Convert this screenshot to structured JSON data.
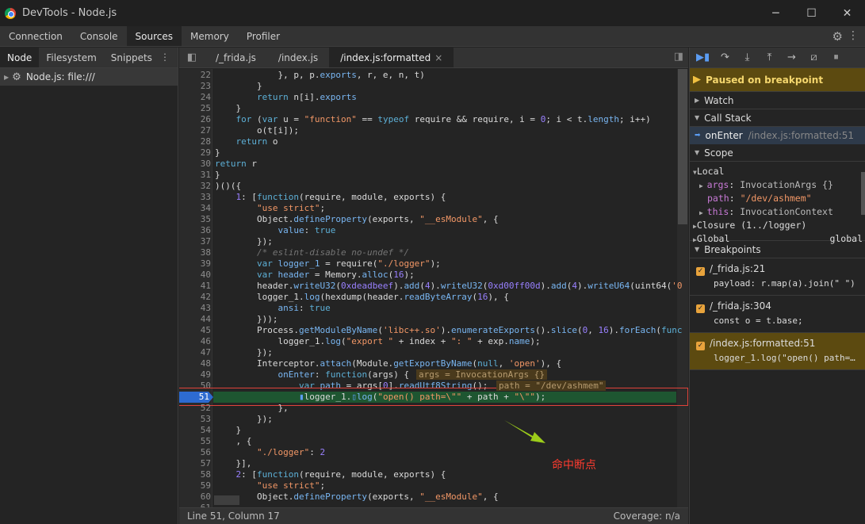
{
  "window": {
    "title": "DevTools - Node.js",
    "minimize": "─",
    "maximize": "☐",
    "close": "✕"
  },
  "main_tabs": [
    "Connection",
    "Console",
    "Sources",
    "Memory",
    "Profiler"
  ],
  "left": {
    "tabs": [
      "Node",
      "Filesystem",
      "Snippets"
    ],
    "more": "⋮",
    "tree_item": "Node.js: file:///"
  },
  "file_tabs": [
    "/_frida.js",
    "/index.js",
    "/index.js:formatted"
  ],
  "close_glyph": "×",
  "code": {
    "highlight_line": 51,
    "lines": [
      {
        "n": "22",
        "h": "            }, p, p.<span class=\"p\">exports</span>, r, e, n, t)"
      },
      {
        "n": "23",
        "h": "        }"
      },
      {
        "n": "24",
        "h": "        <span class=\"k\">return</span> n[i].<span class=\"p\">exports</span>"
      },
      {
        "n": "25",
        "h": "    }"
      },
      {
        "n": "26",
        "h": "    <span class=\"k\">for</span> (<span class=\"k\">var</span> u = <span class=\"s\">\"function\"</span> == <span class=\"k\">typeof</span> require &amp;&amp; require, i = <span class=\"n\">0</span>; i &lt; t.<span class=\"p\">length</span>; i++)"
      },
      {
        "n": "27",
        "h": "        o(t[i]);"
      },
      {
        "n": "28",
        "h": "    <span class=\"k\">return</span> o"
      },
      {
        "n": "29",
        "h": "}"
      },
      {
        "n": "30",
        "h": "<span class=\"k\">return</span> r"
      },
      {
        "n": "31",
        "h": "}"
      },
      {
        "n": "32",
        "h": ")()({"
      },
      {
        "n": "33",
        "h": "    <span class=\"n\">1</span>: [<span class=\"k\">function</span>(require, module, exports) {"
      },
      {
        "n": "34",
        "h": "        <span class=\"s\">\"use strict\"</span>;"
      },
      {
        "n": "35",
        "h": "        Object.<span class=\"p\">defineProperty</span>(exports, <span class=\"s\">\"__esModule\"</span>, {"
      },
      {
        "n": "36",
        "h": "            <span class=\"p\">value</span>: <span class=\"k\">true</span>"
      },
      {
        "n": "37",
        "h": "        });"
      },
      {
        "n": "38",
        "h": "        <span class=\"c\">/* eslint-disable no-undef */</span>"
      },
      {
        "n": "39",
        "h": "        <span class=\"k\">var</span> <span class=\"p\">logger_1</span> = require(<span class=\"s\">\"./logger\"</span>);"
      },
      {
        "n": "40",
        "h": "        <span class=\"k\">var</span> <span class=\"p\">header</span> = Memory.<span class=\"p\">alloc</span>(<span class=\"n\">16</span>);"
      },
      {
        "n": "41",
        "h": "        header.<span class=\"p\">writeU32</span>(<span class=\"n\">0xdeadbeef</span>).<span class=\"p\">add</span>(<span class=\"n\">4</span>).<span class=\"p\">writeU32</span>(<span class=\"n\">0xd00ff00d</span>).<span class=\"p\">add</span>(<span class=\"n\">4</span>).<span class=\"p\">writeU64</span>(uint64(<span class=\"s\">'0</span>"
      },
      {
        "n": "42",
        "h": "        logger_1.<span class=\"p\">log</span>(hexdump(header.<span class=\"p\">readByteArray</span>(<span class=\"n\">16</span>), {"
      },
      {
        "n": "43",
        "h": "            <span class=\"p\">ansi</span>: <span class=\"k\">true</span>"
      },
      {
        "n": "44",
        "h": "        }));"
      },
      {
        "n": "45",
        "h": "        Process.<span class=\"p\">getModuleByName</span>(<span class=\"s\">'libc++.so'</span>).<span class=\"p\">enumerateExports</span>().<span class=\"p\">slice</span>(<span class=\"n\">0</span>, <span class=\"n\">16</span>).<span class=\"p\">forEach</span>(<span class=\"k\">func</span>"
      },
      {
        "n": "46",
        "h": "            logger_1.<span class=\"p\">log</span>(<span class=\"s\">\"export \"</span> + index + <span class=\"s\">\": \"</span> + exp.<span class=\"p\">name</span>);"
      },
      {
        "n": "47",
        "h": "        });"
      },
      {
        "n": "48",
        "h": "        Interceptor.<span class=\"p\">attach</span>(Module.<span class=\"p\">getExportByName</span>(<span class=\"k\">null</span>, <span class=\"s\">'open'</span>), {"
      },
      {
        "n": "49",
        "h": "            <span class=\"p\">onEnter</span>: <span class=\"k\">function</span>(args) {"
      },
      {
        "n": "50",
        "h": "                <span class=\"k\">var</span> <span class=\"p\">path</span> = args[<span class=\"n\">0</span>].<span class=\"p\">readUtf8String</span>();"
      },
      {
        "n": "51",
        "h": "                <span style=\"color:#5b9cf2\">▮</span>logger_1.<span style=\"color:#5b9cf2\">▯</span><span class=\"p\">log</span>(<span class=\"s\">\"open() path=\\\"\"</span> + path + <span class=\"s\">\"\\\"\"</span>);"
      },
      {
        "n": "52",
        "h": "            },"
      },
      {
        "n": "53",
        "h": "        });"
      },
      {
        "n": "54",
        "h": "    }"
      },
      {
        "n": "55",
        "h": "    , {"
      },
      {
        "n": "56",
        "h": "        <span class=\"s\">\"./logger\"</span>: <span class=\"n\">2</span>"
      },
      {
        "n": "57",
        "h": "    }],"
      },
      {
        "n": "58",
        "h": "    <span class=\"n\">2</span>: [<span class=\"k\">function</span>(require, module, exports) {"
      },
      {
        "n": "59",
        "h": "        <span class=\"s\">\"use strict\"</span>;"
      },
      {
        "n": "60",
        "h": "        Object.<span class=\"p\">defineProperty</span>(exports, <span class=\"s\">\"__esModule\"</span>, {"
      },
      {
        "n": "61",
        "h": ""
      }
    ],
    "inline_values": [
      {
        "line": 49,
        "text": "args = InvocationArgs {}"
      },
      {
        "line": 50,
        "text": "path = \"/dev/ashmem\""
      }
    ]
  },
  "annotation": "命中断点",
  "status": {
    "position": "Line 51, Column 17",
    "coverage": "Coverage: n/a"
  },
  "debugger": {
    "paused": "Paused on breakpoint",
    "watch": "Watch",
    "call_stack": "Call Stack",
    "frame": {
      "name": "onEnter",
      "location": "/index.js:formatted:51"
    },
    "scope": "Scope",
    "local": "Local",
    "vars": [
      {
        "name": "args",
        "value": "InvocationArgs {}",
        "expandable": true
      },
      {
        "name": "path",
        "value": "\"/dev/ashmem\"",
        "expandable": false
      },
      {
        "name": "this",
        "value": "InvocationContext",
        "expandable": true
      }
    ],
    "closure": "Closure (1../logger)",
    "global": "Global",
    "global_value": "global",
    "breakpoints_title": "Breakpoints",
    "breakpoints": [
      {
        "file": "/_frida.js:21",
        "code": "payload: r.map(a).join(\" \")"
      },
      {
        "file": "/_frida.js:304",
        "code": "const o = t.base;"
      },
      {
        "file": "/index.js:formatted:51",
        "code": "logger_1.log(\"open() path=…"
      }
    ]
  },
  "colors": {
    "accent": "#5b9cf2",
    "pause_bg": "#5c4a10",
    "highlight": "#1e5631",
    "annotation": "#ff3b2f"
  }
}
